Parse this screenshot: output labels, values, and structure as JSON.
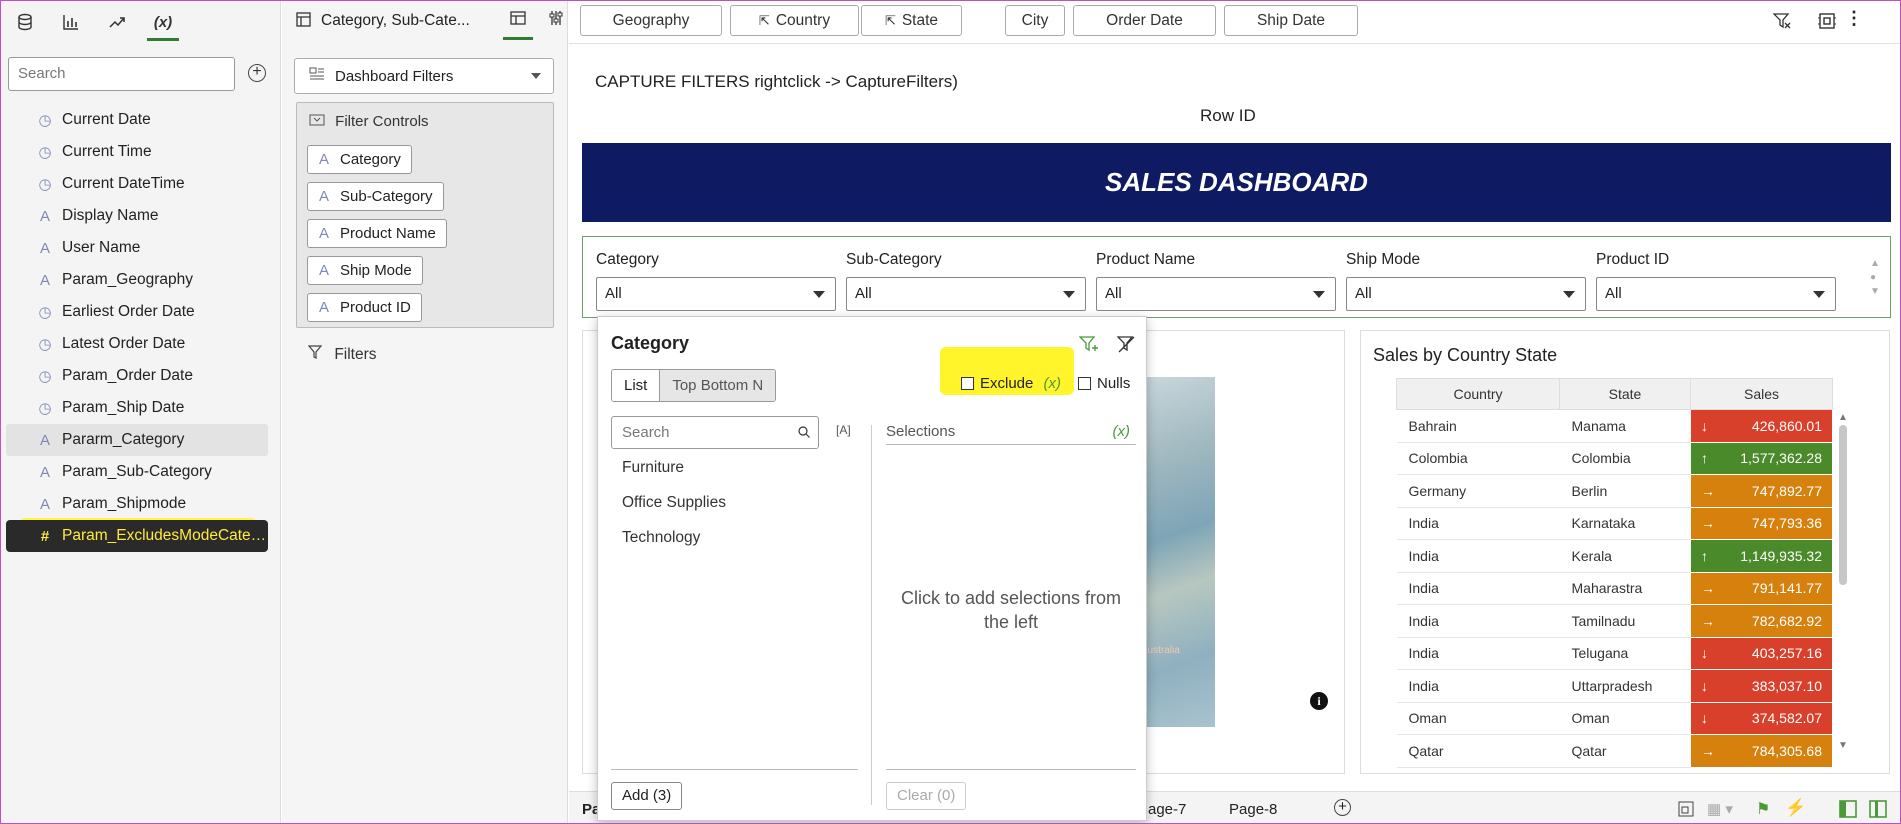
{
  "left_panel": {
    "tabs": [
      "data-icon",
      "chart-icon",
      "trend-icon",
      "(x)"
    ],
    "search_placeholder": "Search",
    "items": [
      {
        "label": "Current Date",
        "icon": "clock-icon"
      },
      {
        "label": "Current Time",
        "icon": "clock-icon"
      },
      {
        "label": "Current DateTime",
        "icon": "clock-icon"
      },
      {
        "label": "Display Name",
        "icon": "text-param-icon"
      },
      {
        "label": "User Name",
        "icon": "text-param-icon"
      },
      {
        "label": "Param_Geography",
        "icon": "text-param-icon"
      },
      {
        "label": "Earliest Order Date",
        "icon": "clock-icon"
      },
      {
        "label": "Latest Order Date",
        "icon": "clock-icon"
      },
      {
        "label": "Param_Order Date",
        "icon": "clock-icon"
      },
      {
        "label": "Param_Ship Date",
        "icon": "clock-icon"
      },
      {
        "label": "Pararm_Category",
        "icon": "text-param-icon"
      },
      {
        "label": "Param_Sub-Category",
        "icon": "text-param-icon"
      },
      {
        "label": "Param_Shipmode",
        "icon": "text-param-icon"
      },
      {
        "label": "Param_ExcludesModeCate…",
        "icon": "number-param-icon"
      }
    ]
  },
  "middle_panel": {
    "title": "Category, Sub-Cate...",
    "dashboard_filters": "Dashboard Filters",
    "filter_controls_title": "Filter Controls",
    "chips": [
      "Category",
      "Sub-Category",
      "Product Name",
      "Ship Mode",
      "Product ID"
    ],
    "filters_label": "Filters"
  },
  "topbar": {
    "pills": [
      "Geography",
      "Country",
      "State",
      "City",
      "Order Date",
      "Ship Date"
    ]
  },
  "canvas": {
    "caption": "CAPTURE FILTERS rightclick -> CaptureFilters)",
    "row_id": "Row ID",
    "banner": "SALES DASHBOARD",
    "filters": [
      {
        "label": "Category",
        "value": "All"
      },
      {
        "label": "Sub-Category",
        "value": "All"
      },
      {
        "label": "Product Name",
        "value": "All"
      },
      {
        "label": "Ship Mode",
        "value": "All"
      },
      {
        "label": "Product ID",
        "value": "All"
      }
    ]
  },
  "popup": {
    "title": "Category",
    "tab_list": "List",
    "tab_topn": "Top Bottom N",
    "exclude": "Exclude",
    "exclude_var": "(x)",
    "nulls": "Nulls",
    "search_placeholder": "Search",
    "selections": "Selections",
    "selections_var": "(x)",
    "items": [
      "Furniture",
      "Office Supplies",
      "Technology"
    ],
    "empty_hint": "Click to add selections from the left",
    "add_btn": "Add (3)",
    "clear_btn": "Clear (0)"
  },
  "table": {
    "title": "Sales by Country State",
    "headers": [
      "Country",
      "State",
      "Sales"
    ],
    "rows": [
      {
        "country": "Bahrain",
        "state": "Manama",
        "sales": "426,860.01",
        "trend": "↓",
        "color": "#d9402b"
      },
      {
        "country": "Colombia",
        "state": "Colombia",
        "sales": "1,577,362.28",
        "trend": "↑",
        "color": "#4a8a2a"
      },
      {
        "country": "Germany",
        "state": "Berlin",
        "sales": "747,892.77",
        "trend": "→",
        "color": "#d6800e"
      },
      {
        "country": "India",
        "state": "Karnataka",
        "sales": "747,793.36",
        "trend": "→",
        "color": "#d6800e"
      },
      {
        "country": "India",
        "state": "Kerala",
        "sales": "1,149,935.32",
        "trend": "↑",
        "color": "#4a8a2a"
      },
      {
        "country": "India",
        "state": "Maharastra",
        "sales": "791,141.77",
        "trend": "→",
        "color": "#d6800e"
      },
      {
        "country": "India",
        "state": "Tamilnadu",
        "sales": "782,682.92",
        "trend": "→",
        "color": "#d6800e"
      },
      {
        "country": "India",
        "state": "Telugana",
        "sales": "403,257.16",
        "trend": "↓",
        "color": "#d9402b"
      },
      {
        "country": "India",
        "state": "Uttarpradesh",
        "sales": "383,037.10",
        "trend": "↓",
        "color": "#d9402b"
      },
      {
        "country": "Oman",
        "state": "Oman",
        "sales": "374,582.07",
        "trend": "↓",
        "color": "#d9402b"
      },
      {
        "country": "Qatar",
        "state": "Qatar",
        "sales": "784,305.68",
        "trend": "→",
        "color": "#d6800e"
      }
    ]
  },
  "bottom": {
    "page_left": "Pa",
    "page7": "age-7",
    "page8": "Page-8"
  },
  "map_label": "australia"
}
